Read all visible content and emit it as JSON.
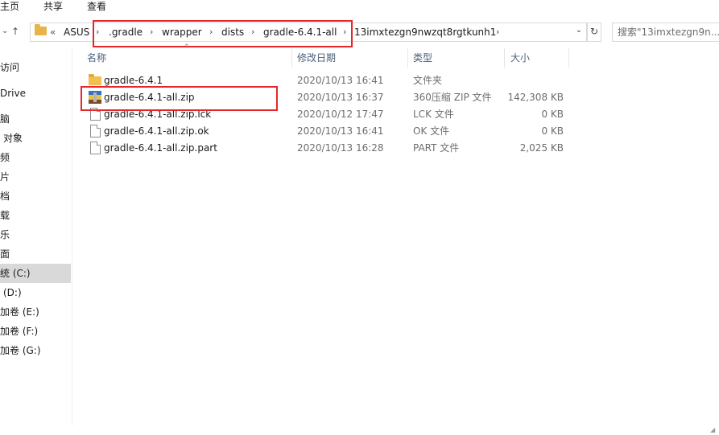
{
  "ribbon": {
    "tabs": [
      "主页",
      "共享",
      "查看"
    ]
  },
  "nav": {
    "up_icon": "up-arrow-icon",
    "breadcrumbs": [
      "ASUS",
      ".gradle",
      "wrapper",
      "dists",
      "gradle-6.4.1-all",
      "13imxtezgn9nwzqt8rgtkunh1"
    ],
    "overflow": "«",
    "search_placeholder": "搜索\"13imxtezgn9n..."
  },
  "sidebar": {
    "items": [
      {
        "label": "访问"
      },
      {
        "label": "Drive"
      },
      {
        "label": "脑"
      },
      {
        "label": "对象"
      },
      {
        "label": "频"
      },
      {
        "label": "片"
      },
      {
        "label": "档"
      },
      {
        "label": "载"
      },
      {
        "label": "乐"
      },
      {
        "label": "面"
      },
      {
        "label": "统 (C:)",
        "selected": true
      },
      {
        "label": "(D:)"
      },
      {
        "label": "加卷 (E:)"
      },
      {
        "label": "加卷 (F:)"
      },
      {
        "label": "加卷 (G:)"
      }
    ]
  },
  "columns": {
    "name": "名称",
    "date": "修改日期",
    "type": "类型",
    "size": "大小"
  },
  "files": [
    {
      "name": "gradle-6.4.1",
      "date": "2020/10/13 16:41",
      "type": "文件夹",
      "size": "",
      "icon": "folder-icon"
    },
    {
      "name": "gradle-6.4.1-all.zip",
      "date": "2020/10/13 16:37",
      "type": "360压缩 ZIP 文件",
      "size": "142,308 KB",
      "icon": "zip-archive-icon"
    },
    {
      "name": "gradle-6.4.1-all.zip.lck",
      "date": "2020/10/12 17:47",
      "type": "LCK 文件",
      "size": "0 KB",
      "icon": "file-icon"
    },
    {
      "name": "gradle-6.4.1-all.zip.ok",
      "date": "2020/10/13 16:41",
      "type": "OK 文件",
      "size": "0 KB",
      "icon": "file-icon"
    },
    {
      "name": "gradle-6.4.1-all.zip.part",
      "date": "2020/10/13 16:28",
      "type": "PART 文件",
      "size": "2,025 KB",
      "icon": "file-icon"
    }
  ],
  "colors": {
    "highlight": "#e6262b",
    "header_text": "#4c607a",
    "selected_bg": "#d9d9d9"
  }
}
